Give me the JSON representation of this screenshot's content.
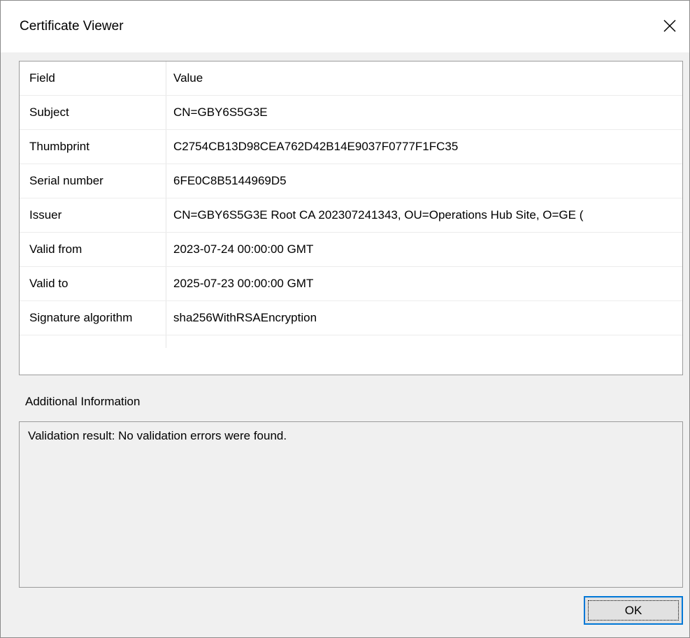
{
  "window": {
    "title": "Certificate Viewer"
  },
  "table": {
    "headers": {
      "field": "Field",
      "value": "Value"
    },
    "rows": [
      {
        "field": "Subject",
        "value": "CN=GBY6S5G3E"
      },
      {
        "field": "Thumbprint",
        "value": "C2754CB13D98CEA762D42B14E9037F0777F1FC35"
      },
      {
        "field": "Serial number",
        "value": "6FE0C8B5144969D5"
      },
      {
        "field": "Issuer",
        "value": "CN=GBY6S5G3E Root CA 202307241343, OU=Operations Hub Site, O=GE ("
      },
      {
        "field": "Valid from",
        "value": "2023-07-24 00:00:00 GMT"
      },
      {
        "field": "Valid to",
        "value": "2025-07-23 00:00:00 GMT"
      },
      {
        "field": "Signature algorithm",
        "value": "sha256WithRSAEncryption"
      }
    ]
  },
  "scrollbar": {
    "left_icon": "chevron-left-icon",
    "right_icon": "chevron-right-icon"
  },
  "additional_info": {
    "label": "Additional Information",
    "text": "Validation result: No validation errors were found."
  },
  "buttons": {
    "ok_label": "OK"
  },
  "colors": {
    "focus_border": "#0078d7",
    "window_bg": "#f0f0f0",
    "scroll_thumb": "#cdcdcd"
  }
}
